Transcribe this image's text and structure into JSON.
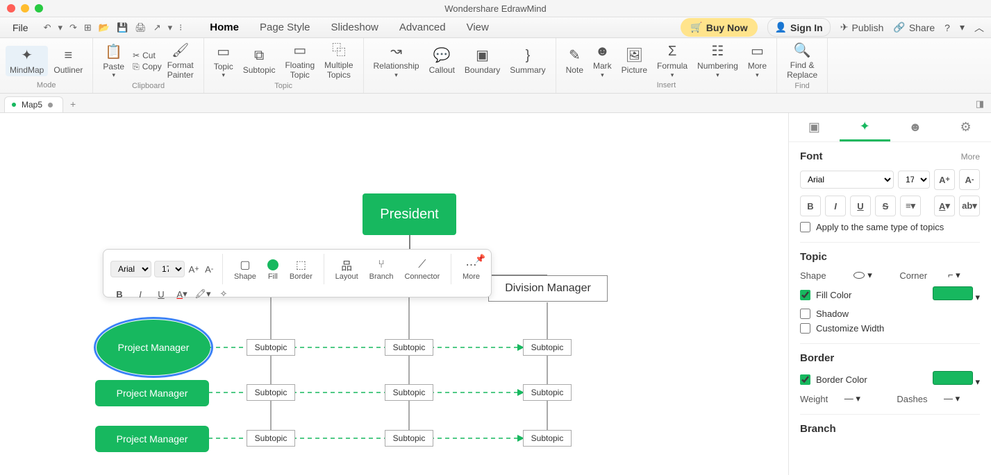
{
  "app_title": "Wondershare EdrawMind",
  "menubar": {
    "file": "File"
  },
  "main_tabs": [
    "Home",
    "Page Style",
    "Slideshow",
    "Advanced",
    "View"
  ],
  "active_main_tab": "Home",
  "actions": {
    "buy": "Buy Now",
    "signin": "Sign In",
    "publish": "Publish",
    "share": "Share"
  },
  "ribbon": {
    "mode": {
      "mindmap": "MindMap",
      "outliner": "Outliner",
      "label": "Mode"
    },
    "clipboard": {
      "paste": "Paste",
      "cut": "Cut",
      "copy": "Copy",
      "format_painter": "Format\nPainter",
      "label": "Clipboard"
    },
    "topic": {
      "topic": "Topic",
      "subtopic": "Subtopic",
      "floating": "Floating\nTopic",
      "multiple": "Multiple\nTopics",
      "label": "Topic"
    },
    "relationship": "Relationship",
    "callout": "Callout",
    "boundary": "Boundary",
    "summary": "Summary",
    "insert": {
      "note": "Note",
      "mark": "Mark",
      "picture": "Picture",
      "formula": "Formula",
      "numbering": "Numbering",
      "more": "More",
      "label": "Insert"
    },
    "find": {
      "find_replace": "Find &\nReplace",
      "label": "Find"
    }
  },
  "doc_tab": "Map5",
  "canvas": {
    "president": "President",
    "division_manager": "Division Manager",
    "project_manager": "Project Manager",
    "subtopic": "Subtopic"
  },
  "minibar": {
    "font": "Arial",
    "size": "17",
    "shape": "Shape",
    "fill": "Fill",
    "border": "Border",
    "layout": "Layout",
    "branch": "Branch",
    "connector": "Connector",
    "more": "More"
  },
  "panel": {
    "font": {
      "title": "Font",
      "more": "More",
      "family": "Arial",
      "size": "17",
      "apply_same": "Apply to the same type of topics"
    },
    "topic": {
      "title": "Topic",
      "shape": "Shape",
      "corner": "Corner",
      "fill_color": "Fill Color",
      "shadow": "Shadow",
      "customize_width": "Customize Width"
    },
    "border": {
      "title": "Border",
      "border_color": "Border Color",
      "weight": "Weight",
      "dashes": "Dashes"
    },
    "branch": {
      "title": "Branch"
    }
  },
  "colors": {
    "accent": "#17b85f"
  }
}
